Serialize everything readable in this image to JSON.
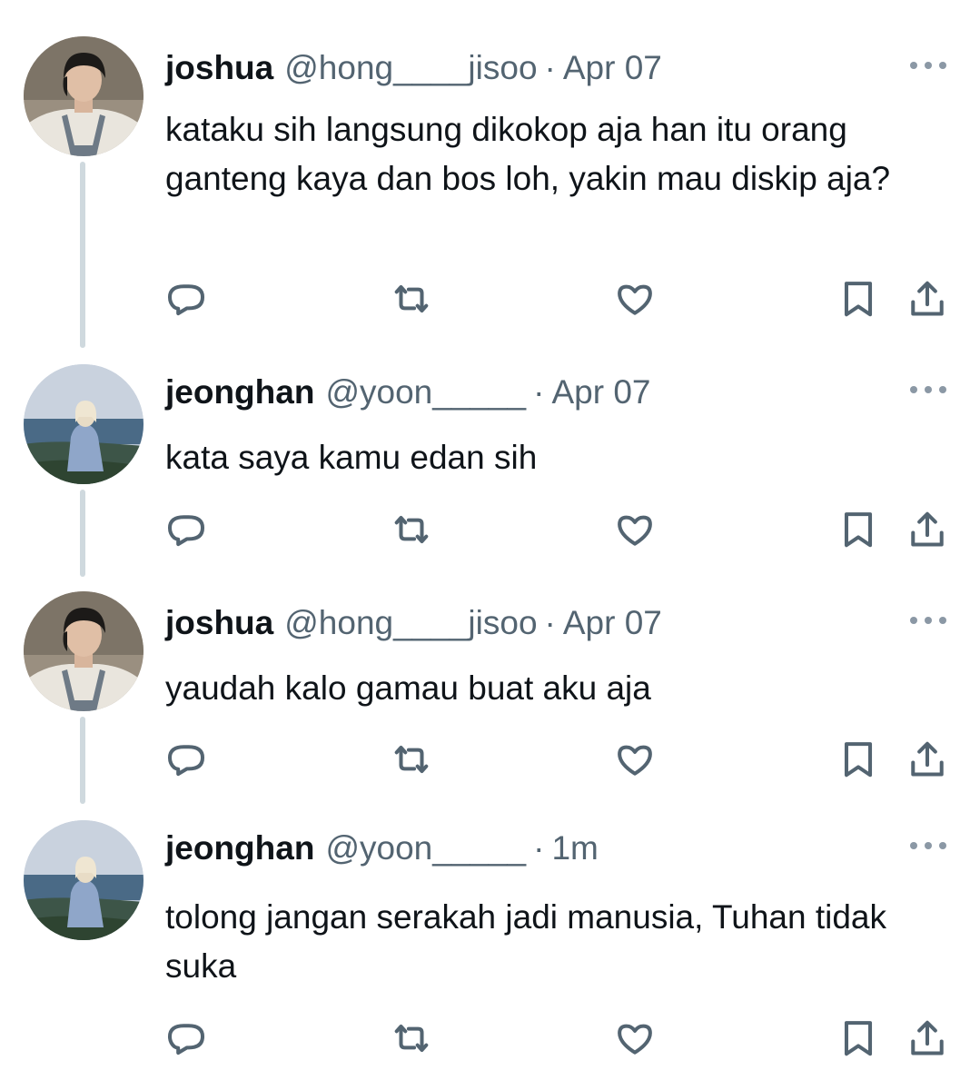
{
  "tweets": [
    {
      "name": "joshua",
      "handle": "@hong____jisoo",
      "separator": "·",
      "time": "Apr 07",
      "text": "kataku sih langsung dikokop aja han itu orang ganteng kaya dan bos loh, yakin mau diskip aja?",
      "avatar": "joshua-avatar"
    },
    {
      "name": "jeonghan",
      "handle": "@yoon_____",
      "separator": "·",
      "time": "Apr 07",
      "text": "kata saya kamu edan sih",
      "avatar": "jeonghan-avatar"
    },
    {
      "name": "joshua",
      "handle": "@hong____jisoo",
      "separator": "·",
      "time": "Apr 07",
      "text": "yaudah kalo gamau buat aku aja",
      "avatar": "joshua-avatar"
    },
    {
      "name": "jeonghan",
      "handle": "@yoon_____",
      "separator": "·",
      "time": "1m",
      "text": "tolong jangan serakah jadi manusia, Tuhan tidak suka",
      "avatar": "jeonghan-avatar"
    }
  ],
  "icons": {
    "reply": "reply-icon",
    "retweet": "retweet-icon",
    "like": "heart-icon",
    "bookmark": "bookmark-icon",
    "share": "share-icon",
    "more": "more-icon"
  },
  "colors": {
    "text": "#0f1419",
    "secondary": "#536471",
    "thread_line": "#cfd9de"
  }
}
